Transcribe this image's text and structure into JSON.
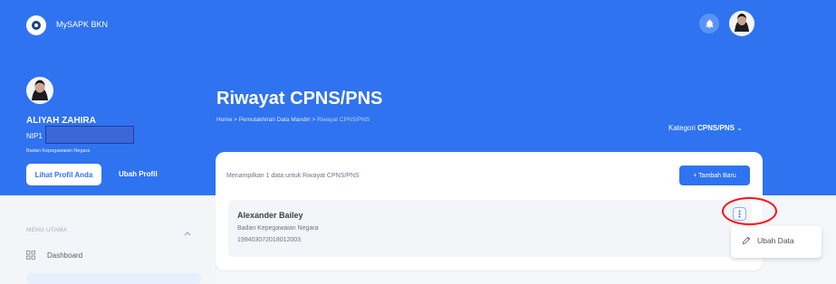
{
  "app": {
    "name": "MySAPK BKN"
  },
  "profile": {
    "name": "ALIYAH ZAHIRA",
    "nip_label": "NIP1",
    "organization": "Badan Kepegawaian Negara",
    "view_profile_button": "Lihat Profil Anda",
    "edit_profile_button": "Ubah Profil"
  },
  "page": {
    "title": "Riwayat CPNS/PNS",
    "breadcrumb": {
      "home": "Home",
      "separator": " > ",
      "parent": "Pemutakhiran Data Mandiri",
      "current": "Riwayat CPNS/PNS"
    },
    "kategori_label": "Kategori",
    "kategori_value": "CPNS/PNS"
  },
  "main": {
    "summary": "Menampilkan 1 data untuk Riwayat CPNS/PNS",
    "add_button": "+ Tambah Baru",
    "record": {
      "name": "Alexander Bailey",
      "organization": "Badan Kepegawaian Negara",
      "nip": "199403072018012003"
    },
    "actions": {
      "edit": "Ubah Data"
    }
  },
  "sidebar": {
    "section_title": "MENU UTAMA",
    "items": [
      {
        "label": "Dashboard",
        "icon": "dashboard-icon"
      }
    ]
  },
  "icons": {
    "logo": "mysapk-logo",
    "bell": "bell-icon",
    "avatar": "avatar-icon",
    "kebab": "more-vertical-icon",
    "pencil": "pencil-icon"
  },
  "colors": {
    "primary": "#2f73f0",
    "background": "#f4f6fa",
    "highlight": "#ff1010"
  }
}
